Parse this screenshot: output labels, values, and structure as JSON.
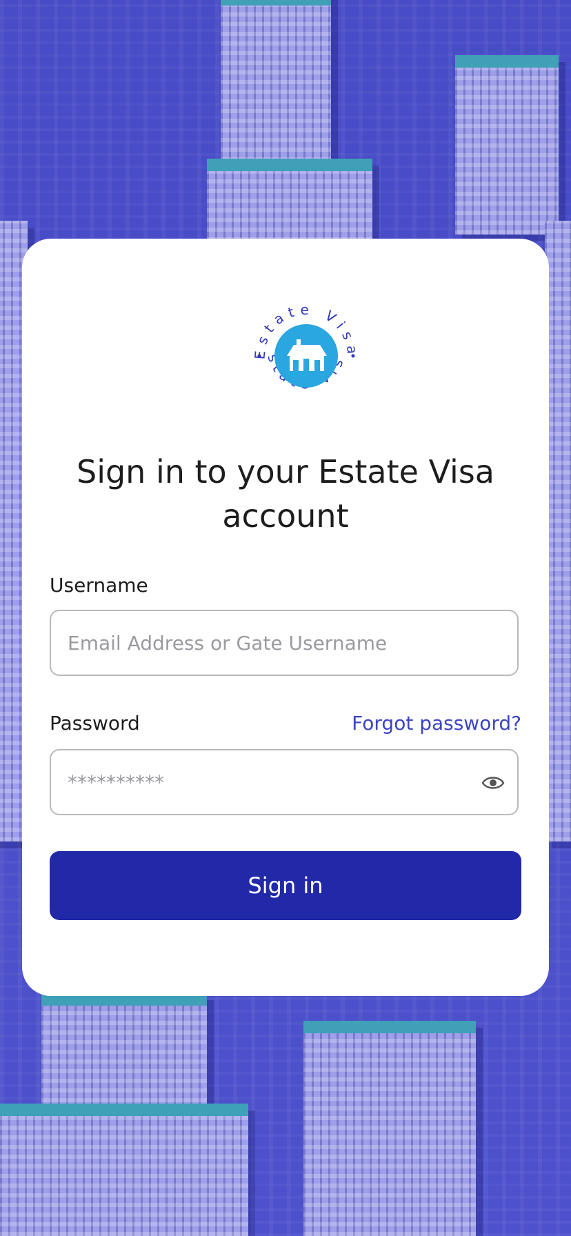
{
  "brand": {
    "logo_text": "Estate Visa"
  },
  "title": "Sign in to your Estate Visa account",
  "form": {
    "username_label": "Username",
    "username_placeholder": "Email Address or Gate Username",
    "password_label": "Password",
    "password_value": "**********",
    "forgot_password": "Forgot password?",
    "submit_label": "Sign in"
  },
  "icons": {
    "logo_house": "house-icon",
    "password_toggle": "eye-icon"
  },
  "colors": {
    "accent": "#2229a8",
    "link": "#3b44c4",
    "logo_circle": "#2aa6e0",
    "background_tint": "#4a52c4"
  }
}
